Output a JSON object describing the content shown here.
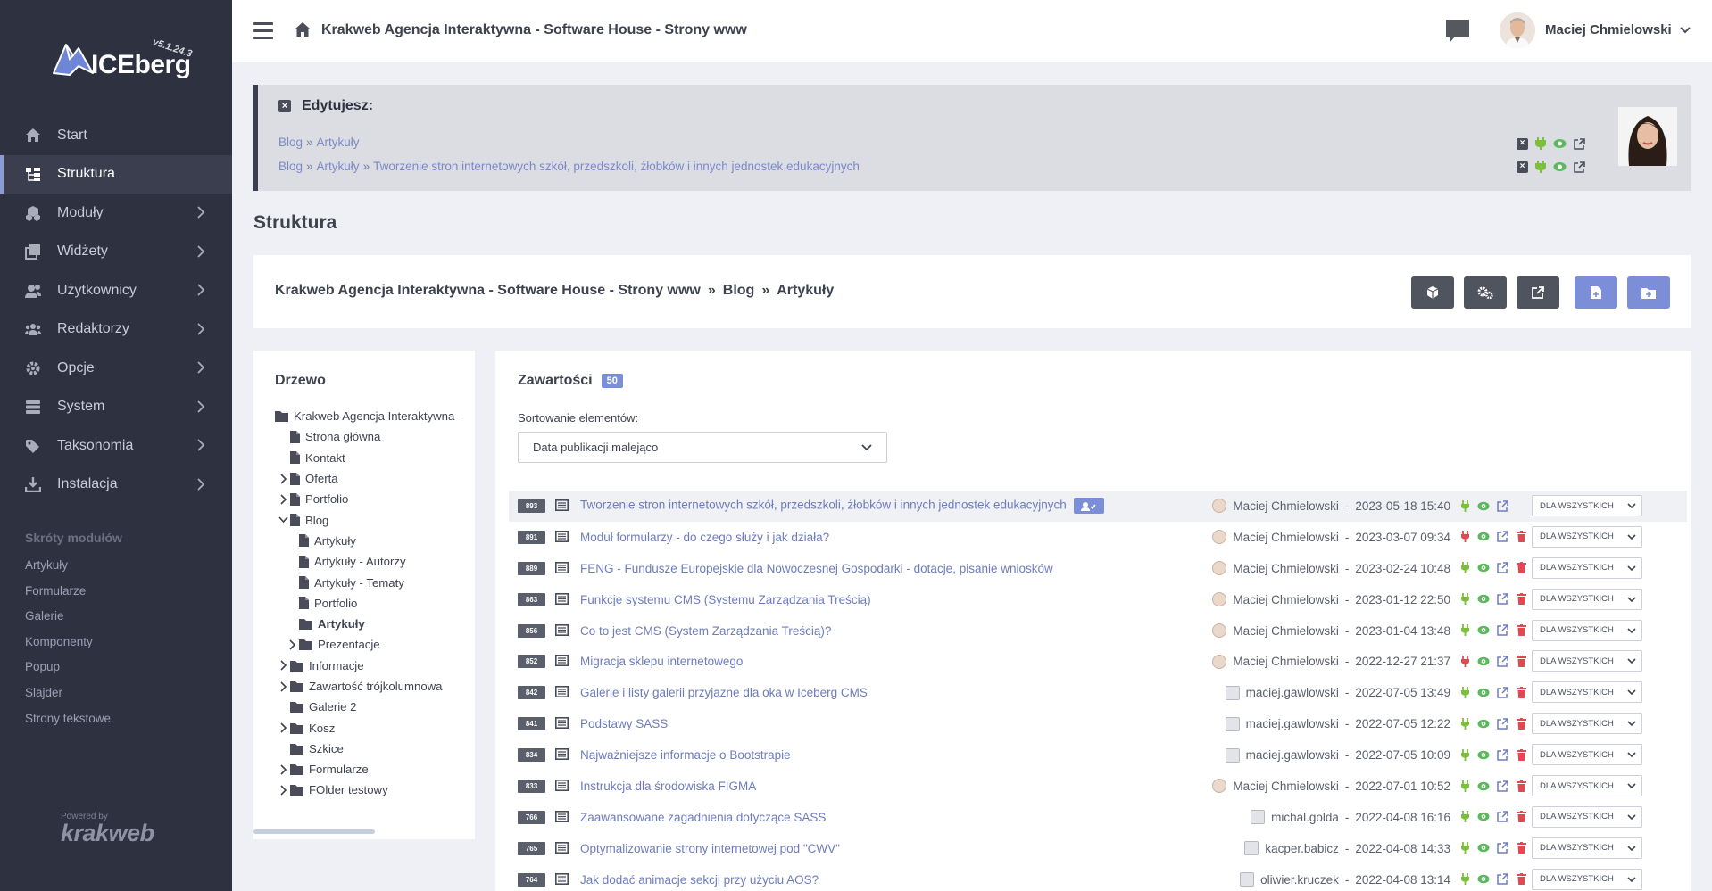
{
  "app": {
    "logo_text": "ICEberg",
    "version": "v5.1.24.3"
  },
  "sidebar": {
    "items": [
      {
        "label": "Start",
        "icon": "home-icon"
      },
      {
        "label": "Struktura",
        "icon": "sitemap-icon",
        "active": true
      },
      {
        "label": "Moduły",
        "icon": "cubes-icon"
      },
      {
        "label": "Widżety",
        "icon": "clone-icon"
      },
      {
        "label": "Użytkownicy",
        "icon": "users-icon"
      },
      {
        "label": "Redaktorzy",
        "icon": "group-icon"
      },
      {
        "label": "Opcje",
        "icon": "gear-icon"
      },
      {
        "label": "System",
        "icon": "server-icon"
      },
      {
        "label": "Taksonomia",
        "icon": "tags-icon"
      },
      {
        "label": "Instalacja",
        "icon": "download-icon"
      }
    ],
    "shortcuts_title": "Skróty modułów",
    "shortcuts": [
      "Artykuły",
      "Formularze",
      "Galerie",
      "Komponenty",
      "Popup",
      "Slajder",
      "Strony tekstowe"
    ],
    "powered_by": "Powered by",
    "powered_brand": "krakweb"
  },
  "topbar": {
    "site_title": "Krakweb Agencja Interaktywna - Software House - Strony www",
    "user_name": "Maciej Chmielowski"
  },
  "editing": {
    "title": "Edytujesz:",
    "lines": [
      {
        "crumbs": [
          "Blog",
          "Artykuły"
        ]
      },
      {
        "crumbs": [
          "Blog",
          "Artykuły",
          "Tworzenie stron internetowych szkół, przedszkoli, żłobków i innych jednostek edukacyjnych"
        ]
      }
    ],
    "separator": "»"
  },
  "page": {
    "heading": "Struktura",
    "path": [
      "Krakweb Agencja Interaktywna - Software House - Strony www",
      "Blog",
      "Artykuły"
    ],
    "path_sep": "»"
  },
  "tree": {
    "title": "Drzewo",
    "nodes": [
      {
        "label": "Krakweb Agencja Interaktywna -",
        "depth": 0,
        "toggle": "",
        "type": "folder"
      },
      {
        "label": "Strona główna",
        "depth": 1,
        "toggle": "",
        "type": "file"
      },
      {
        "label": "Kontakt",
        "depth": 1,
        "toggle": "",
        "type": "file"
      },
      {
        "label": "Oferta",
        "depth": 1,
        "toggle": "closed",
        "type": "file"
      },
      {
        "label": "Portfolio",
        "depth": 1,
        "toggle": "closed",
        "type": "file"
      },
      {
        "label": "Blog",
        "depth": 1,
        "toggle": "open",
        "type": "file"
      },
      {
        "label": "Artykuły",
        "depth": 2,
        "toggle": "",
        "type": "file"
      },
      {
        "label": "Artykuły - Autorzy",
        "depth": 2,
        "toggle": "",
        "type": "file"
      },
      {
        "label": "Artykuły - Tematy",
        "depth": 2,
        "toggle": "",
        "type": "file"
      },
      {
        "label": "Portfolio",
        "depth": 2,
        "toggle": "",
        "type": "file"
      },
      {
        "label": "Artykuły",
        "depth": 2,
        "toggle": "",
        "type": "folder",
        "bold": true
      },
      {
        "label": "Prezentacje",
        "depth": 2,
        "toggle": "closed",
        "type": "folder"
      },
      {
        "label": "Informacje",
        "depth": 1,
        "toggle": "closed",
        "type": "folder"
      },
      {
        "label": "Zawartość trójkolumnowa",
        "depth": 1,
        "toggle": "closed",
        "type": "folder"
      },
      {
        "label": "Galerie 2",
        "depth": 1,
        "toggle": "",
        "type": "folder"
      },
      {
        "label": "Kosz",
        "depth": 1,
        "toggle": "closed",
        "type": "folder"
      },
      {
        "label": "Szkice",
        "depth": 1,
        "toggle": "",
        "type": "folder"
      },
      {
        "label": "Formularze",
        "depth": 1,
        "toggle": "closed",
        "type": "folder"
      },
      {
        "label": "FOlder testowy",
        "depth": 1,
        "toggle": "closed",
        "type": "folder"
      }
    ]
  },
  "content": {
    "title": "Zawartości",
    "count": "50",
    "sort_label": "Sortowanie elementów:",
    "sort_value": "Data publikacji malejąco",
    "rows": [
      {
        "id": "893",
        "title": "Tworzenie stron internetowych szkół, przedszkoli, żłobków i innych jednostek edukacyjnych",
        "author": "Maciej Chmielowski",
        "date": "2023-05-18 15:40",
        "visibility": "DLA WSZYSTKICH",
        "active": true,
        "has_user_badge": true,
        "deletable": false,
        "avatar": "photo"
      },
      {
        "id": "891",
        "title": "Moduł formularzy - do czego służy i jak działa?",
        "author": "Maciej Chmielowski",
        "date": "2023-03-07 09:34",
        "visibility": "DLA WSZYSTKICH",
        "active": false,
        "deletable": true,
        "avatar": "photo"
      },
      {
        "id": "889",
        "title": "FENG - Fundusze Europejskie dla Nowoczesnej Gospodarki - dotacje, pisanie wniosków",
        "author": "Maciej Chmielowski",
        "date": "2023-02-24 10:48",
        "visibility": "DLA WSZYSTKICH",
        "active": true,
        "deletable": true,
        "avatar": "photo"
      },
      {
        "id": "863",
        "title": "Funkcje systemu CMS (Systemu Zarządzania Treścią)",
        "author": "Maciej Chmielowski",
        "date": "2023-01-12 22:50",
        "visibility": "DLA WSZYSTKICH",
        "active": true,
        "deletable": true,
        "avatar": "photo"
      },
      {
        "id": "856",
        "title": "Co to jest CMS (System Zarządzania Treścią)?",
        "author": "Maciej Chmielowski",
        "date": "2023-01-04 13:48",
        "visibility": "DLA WSZYSTKICH",
        "active": true,
        "deletable": true,
        "avatar": "photo"
      },
      {
        "id": "852",
        "title": "Migracja sklepu internetowego",
        "author": "Maciej Chmielowski",
        "date": "2022-12-27 21:37",
        "visibility": "DLA WSZYSTKICH",
        "active": false,
        "deletable": true,
        "avatar": "photo"
      },
      {
        "id": "842",
        "title": "Galerie i listy galerii przyjazne dla oka w Iceberg CMS",
        "author": "maciej.gawlowski",
        "date": "2022-07-05 13:49",
        "visibility": "DLA WSZYSTKICH",
        "active": true,
        "deletable": true,
        "avatar": "ghost"
      },
      {
        "id": "841",
        "title": "Podstawy SASS",
        "author": "maciej.gawlowski",
        "date": "2022-07-05 12:22",
        "visibility": "DLA WSZYSTKICH",
        "active": true,
        "deletable": true,
        "avatar": "ghost"
      },
      {
        "id": "834",
        "title": "Najważniejsze informacje o Bootstrapie",
        "author": "maciej.gawlowski",
        "date": "2022-07-05 10:09",
        "visibility": "DLA WSZYSTKICH",
        "active": true,
        "deletable": true,
        "avatar": "ghost"
      },
      {
        "id": "833",
        "title": "Instrukcja dla środowiska FIGMA",
        "author": "Maciej Chmielowski",
        "date": "2022-07-01 10:52",
        "visibility": "DLA WSZYSTKICH",
        "active": true,
        "deletable": true,
        "avatar": "photo"
      },
      {
        "id": "766",
        "title": "Zaawansowane zagadnienia dotyczące SASS",
        "author": "michal.golda",
        "date": "2022-04-08 16:16",
        "visibility": "DLA WSZYSTKICH",
        "active": true,
        "deletable": true,
        "avatar": "ghost"
      },
      {
        "id": "765",
        "title": "Optymalizowanie strony internetowej pod \"CWV\"",
        "author": "kacper.babicz",
        "date": "2022-04-08 14:33",
        "visibility": "DLA WSZYSTKICH",
        "active": true,
        "deletable": true,
        "avatar": "ghost"
      },
      {
        "id": "764",
        "title": "Jak dodać animacje sekcji przy użyciu AOS?",
        "author": "oliwier.kruczek",
        "date": "2022-04-08 13:14",
        "visibility": "DLA WSZYSTKICH",
        "active": true,
        "deletable": true,
        "avatar": "ghost"
      }
    ],
    "author_date_sep": "-"
  },
  "colors": {
    "sidebar_bg": "#2d3140",
    "accent": "#7c8ed8",
    "link": "#6e7cbe",
    "plug_on": "#7cbf3a",
    "plug_off": "#e0494f",
    "eye": "#5cb85c",
    "trash": "#e0494f",
    "external": "#6e7cbe"
  }
}
